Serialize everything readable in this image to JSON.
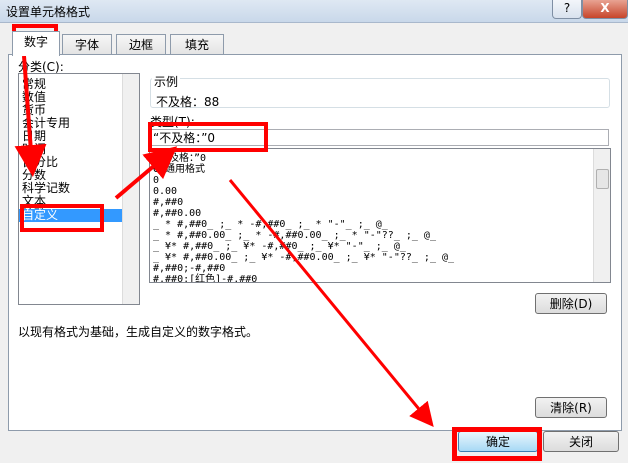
{
  "window": {
    "title": "设置单元格格式",
    "help_label": "?",
    "close_label": "X"
  },
  "tabs": [
    {
      "label": "数字",
      "active": true
    },
    {
      "label": "字体",
      "active": false
    },
    {
      "label": "边框",
      "active": false
    },
    {
      "label": "填充",
      "active": false
    }
  ],
  "category": {
    "label": "分类(C):",
    "items": [
      "常规",
      "数值",
      "货币",
      "会计专用",
      "日期",
      "时间",
      "百分比",
      "分数",
      "科学记数",
      "文本",
      "特殊",
      "自定义"
    ],
    "selected": "自定义"
  },
  "sample": {
    "label": "示例",
    "value": "不及格：88"
  },
  "type": {
    "label": "类型(T):",
    "value": "“不及格：”0"
  },
  "formats": [
    "“不及格：”0",
    "G/通用格式",
    "0",
    "0.00",
    "#,##0",
    "#,##0.00",
    "_ * #,##0_ ;_ * -#,##0_ ;_ * \"-\"_ ;_ @_",
    "_ * #,##0.00_ ;_ * -#,##0.00_ ;_ * \"-\"??_ ;_ @_",
    "_ ¥* #,##0_ ;_ ¥* -#,##0_ ;_ ¥* \"-\"_ ;_ @_",
    "_ ¥* #,##0.00_ ;_ ¥* -#,##0.00_ ;_ ¥* \"-\"??_ ;_ @_",
    "#,##0;-#,##0",
    "#,##0;[红色]-#,##0"
  ],
  "buttons": {
    "delete": "删除(D)",
    "ok": "确定",
    "cancel": "关闭",
    "clear": "清除(R)"
  },
  "description": "以现有格式为基础，生成自定义的数字格式。",
  "colors": {
    "annotation": "#ff0000",
    "selection": "#3399ff"
  }
}
